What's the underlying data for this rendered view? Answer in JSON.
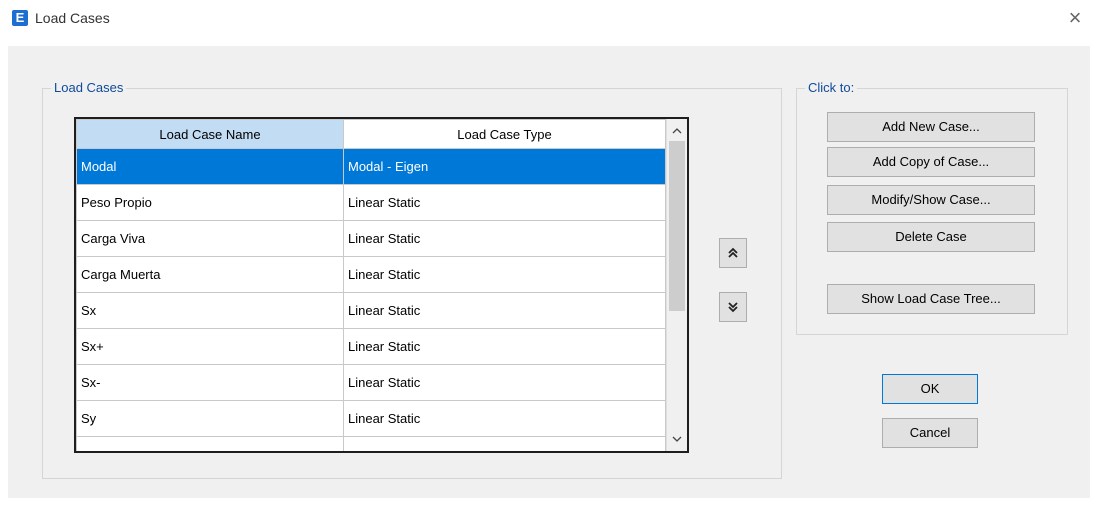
{
  "window": {
    "title": "Load Cases",
    "icon_letter": "E",
    "close_glyph": "×"
  },
  "groups": {
    "load_cases": "Load Cases",
    "click_to": "Click to:"
  },
  "grid": {
    "headers": [
      "Load Case Name",
      "Load Case Type"
    ],
    "rows": [
      {
        "name": "Modal",
        "type": "Modal - Eigen",
        "selected": true
      },
      {
        "name": "Peso Propio",
        "type": "Linear Static"
      },
      {
        "name": "Carga Viva",
        "type": "Linear Static"
      },
      {
        "name": "Carga Muerta",
        "type": "Linear Static"
      },
      {
        "name": "Sx",
        "type": "Linear Static"
      },
      {
        "name": "Sx+",
        "type": "Linear Static"
      },
      {
        "name": "Sx-",
        "type": "Linear Static"
      },
      {
        "name": "Sy",
        "type": "Linear Static"
      },
      {
        "name": "",
        "type": ""
      }
    ]
  },
  "scroll": {
    "up_glyph": "^",
    "down_glyph": "v"
  },
  "move": {
    "up_glyph": "≈",
    "down_glyph": "≈"
  },
  "buttons": {
    "add_new": "Add New Case...",
    "add_copy": "Add Copy of Case...",
    "modify_show": "Modify/Show Case...",
    "delete": "Delete Case",
    "show_tree": "Show Load Case Tree...",
    "ok": "OK",
    "cancel": "Cancel"
  }
}
